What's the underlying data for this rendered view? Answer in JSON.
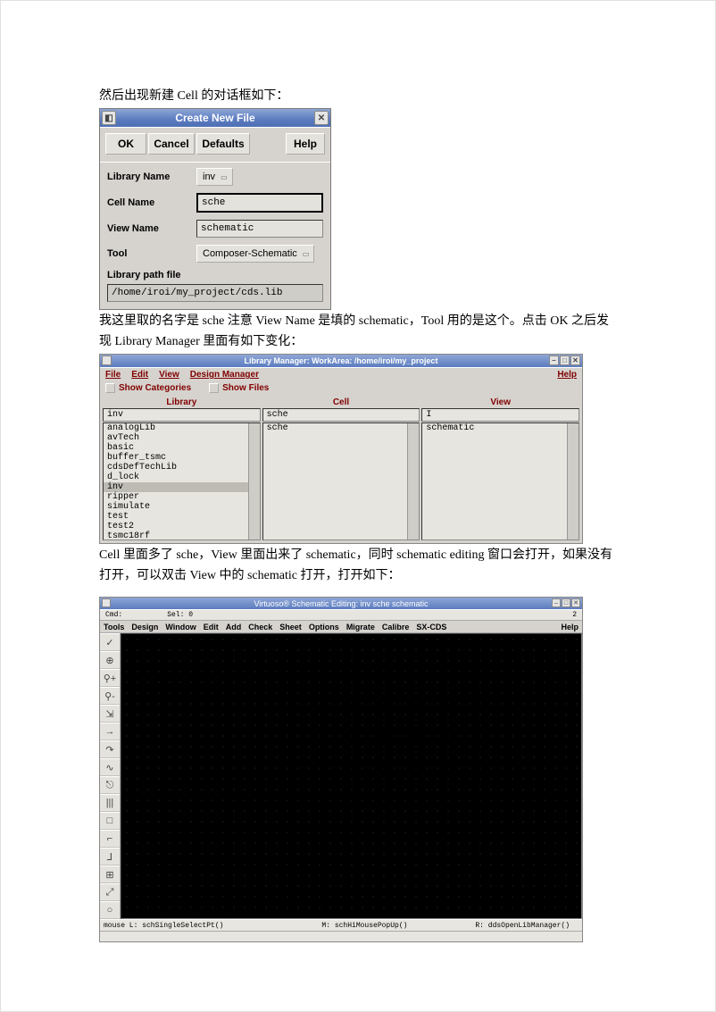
{
  "para1": "然后出现新建 Cell 的对话框如下：",
  "para2": "我这里取的名字是 sche  注意 View Name 是填的 schematic，Tool 用的是这个。点击 OK 之后发现 Library Manager 里面有如下变化：",
  "para3": "Cell 里面多了 sche，View 里面出来了 schematic，同时 schematic editing 窗口会打开，如果没有打开，可以双击 View 中的 schematic 打开，打开如下：",
  "cnf": {
    "title": "Create New File",
    "ok": "OK",
    "cancel": "Cancel",
    "defaults": "Defaults",
    "help": "Help",
    "lbl_lib": "Library Name",
    "lbl_cell": "Cell Name",
    "lbl_view": "View Name",
    "lbl_tool": "Tool",
    "lbl_path": "Library path file",
    "lib_value": "inv",
    "cell_value": "sche",
    "view_value": "schematic",
    "tool_value": "Composer-Schematic",
    "path_value": "/home/iroi/my_project/cds.lib"
  },
  "lm": {
    "title": "Library Manager: WorkArea: /home/iroi/my_project",
    "menu_file": "File",
    "menu_edit": "Edit",
    "menu_view": "View",
    "menu_design": "Design Manager",
    "menu_help": "Help",
    "toggle_cat": "Show Categories",
    "toggle_files": "Show Files",
    "head_lib": "Library",
    "head_cell": "Cell",
    "head_view": "View",
    "lib_input": "inv",
    "cell_input": "sche",
    "view_input": "",
    "libs": [
      "analogLib",
      "avTech",
      "basic",
      "buffer_tsmc",
      "cdsDefTechLib",
      "d_lock",
      "inv",
      "ripper",
      "simulate",
      "test",
      "test2",
      "tsmc18rf"
    ],
    "lib_selected": "inv",
    "cells": [
      "sche"
    ],
    "views": [
      "schematic"
    ]
  },
  "se": {
    "title": "Virtuoso® Schematic Editing: inv sche schematic",
    "status_cmd": "Cmd:",
    "status_sel": "Sel: 0",
    "status_right": "2",
    "menus": [
      "Tools",
      "Design",
      "Window",
      "Edit",
      "Add",
      "Check",
      "Sheet",
      "Options",
      "Migrate",
      "Calibre",
      "SX-CDS"
    ],
    "menu_help": "Help",
    "footer_l": "mouse L: schSingleSelectPt()",
    "footer_m": "M: schHiMousePopUp()",
    "footer_r": "R: ddsOpenLibManager()",
    "tools": [
      "✓",
      "⊕",
      "⚲+",
      "⚲-",
      "⇲",
      "→",
      "↷",
      "∿",
      "⎋",
      "|||",
      "□",
      "⌐",
      "⅃",
      "⊞",
      "⤢",
      "○"
    ]
  }
}
